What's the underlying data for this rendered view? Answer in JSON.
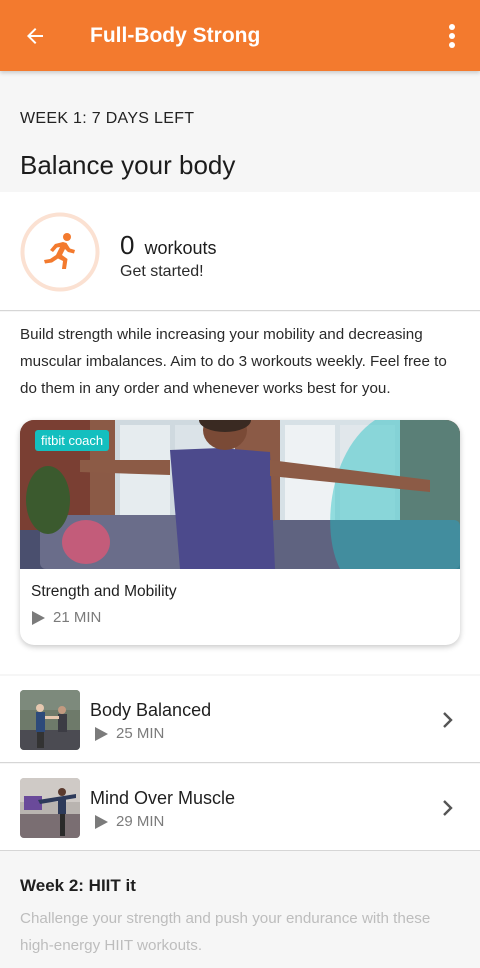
{
  "appbar": {
    "title": "Full-Body Strong",
    "back_icon": "arrow-left-icon",
    "menu_icon": "more-vertical-icon",
    "color": "#f37a2e"
  },
  "week1": {
    "label": "WEEK 1: 7 DAYS LEFT",
    "title": "Balance your body"
  },
  "progress": {
    "count": "0",
    "unit": "workouts",
    "subtitle": "Get started!",
    "icon": "running-person-icon",
    "completed_fraction": 0
  },
  "description": "Build strength while increasing your mobility and decreasing muscular imbalances. Aim to do 3 workouts weekly. Feel free to do them in any order and whenever works best for you.",
  "featured": {
    "badge": "fitbit coach",
    "title": "Strength and Mobility",
    "duration": "21 MIN"
  },
  "workouts": [
    {
      "title": "Body Balanced",
      "duration": "25 MIN"
    },
    {
      "title": "Mind Over Muscle",
      "duration": "29 MIN"
    }
  ],
  "week2": {
    "title": "Week 2: HIIT it",
    "description": "Challenge your strength and push your endurance with these high-energy HIIT workouts."
  }
}
